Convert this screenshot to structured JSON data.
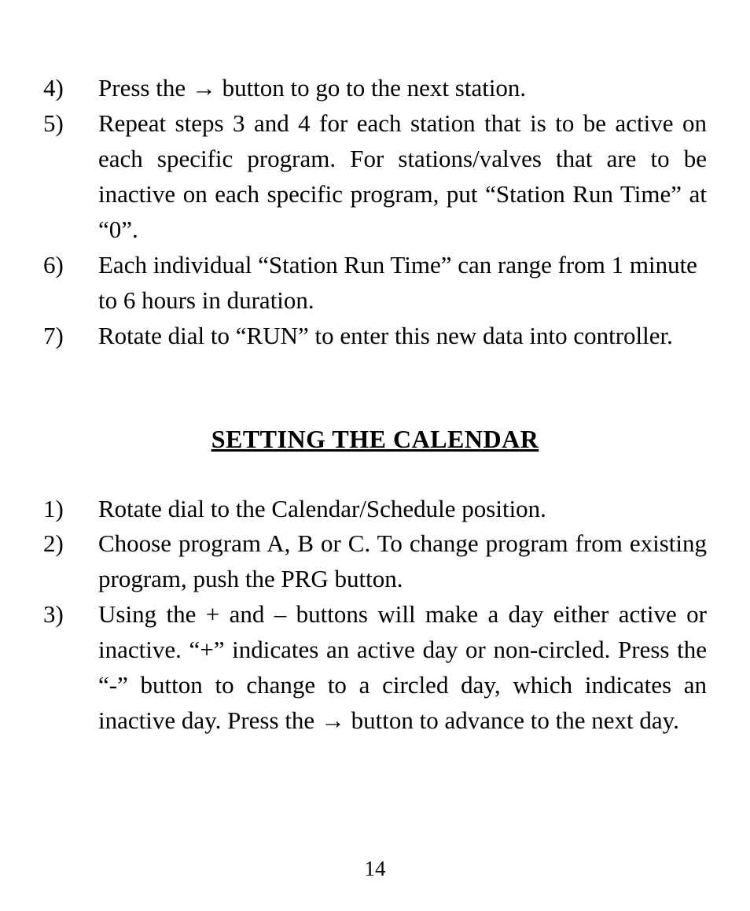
{
  "list1": {
    "items": [
      {
        "num": "4)",
        "text": "Press the → button to go to the next station.",
        "justify": false
      },
      {
        "num": "5)",
        "text": "Repeat steps 3 and 4 for each station that is to be active on each specific program. For stations/valves that are to be inactive on each specific program, put “Station Run Time” at “0”.",
        "justify": true
      },
      {
        "num": "6)",
        "text": "Each individual “Station Run Time” can range from 1 minute to 6 hours in duration.",
        "justify": false
      },
      {
        "num": "7)",
        "text": "Rotate dial to “RUN” to enter this new data into controller.",
        "justify": false
      }
    ]
  },
  "section_heading": "SETTING THE CALENDAR",
  "list2": {
    "items": [
      {
        "num": "1)",
        "text": "Rotate dial to the Calendar/Schedule position.",
        "justify": false
      },
      {
        "num": "2)",
        "text": "Choose program A, B or C. To change program from existing program, push the PRG button.",
        "justify": true
      },
      {
        "num": "3)",
        "text": "Using the + and – buttons will make a day either active or inactive. “+” indicates an active day or non-circled. Press the “-” button to change to a circled day, which indicates an inactive day. Press the → button to advance to the next day.",
        "justify": true
      }
    ]
  },
  "page_number": "14"
}
